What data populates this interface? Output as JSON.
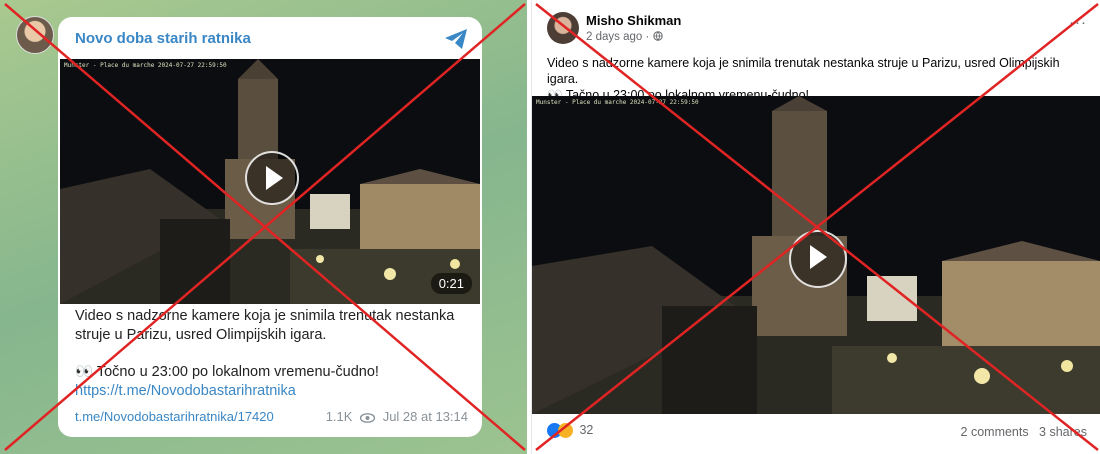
{
  "telegram": {
    "channel_name": "Novo doba starih ratnika",
    "video_stamp": "Munster - Place du marche 2024-07-27 22:59:50",
    "duration": "0:21",
    "text_line1": "Video s nadzorne kamere koja je snimila trenutak nestanka struje u Parizu, usred Olimpijskih igara.",
    "text_line2": "Točno u 23:00 po lokalnom vremenu-čudno!",
    "emoji": "👀",
    "link": "https://t.me/Novodobastarihratnika",
    "post_link": "t.me/Novodobastarihratnika/17420",
    "views": "1.1K",
    "date": "Jul 28 at 13:14",
    "icons": [
      "telegram-plane-icon",
      "play-icon",
      "eye-icon"
    ]
  },
  "facebook": {
    "author": "Misho Shikman",
    "time": "2 days ago",
    "text_line1": "Video s nadzorne kamere koja je snimila trenutak nestanka struje u Parizu, usred Olimpijskih igara.",
    "emoji": "👀",
    "text_line2": "Tačno u 23:00 po lokalnom vremenu-čudno!",
    "video_stamp": "Munster - Place du marche 2024-07-27 22:59:50",
    "reactions_count": "32",
    "comments": "2 comments",
    "shares": "3 shares",
    "icons": [
      "globe-icon",
      "more-icon",
      "play-icon",
      "like-icon",
      "wow-icon"
    ]
  },
  "colors": {
    "strike": "#e02424",
    "telegram_blue": "#3a87c5",
    "fb_like": "#1877f2"
  }
}
